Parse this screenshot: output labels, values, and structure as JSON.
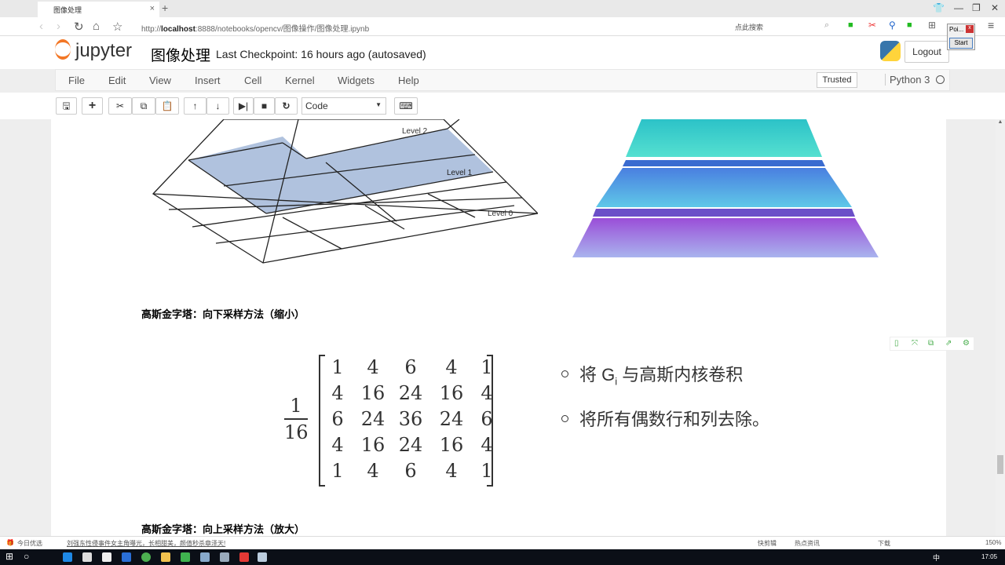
{
  "browser": {
    "tab_title": "图像处理",
    "url_prefix": "http://",
    "url_host": "localhost",
    "url_rest": ":8888/notebooks/opencv/图像操作/图像处理.ipynb",
    "search_placeholder": "点此搜索"
  },
  "header": {
    "logo": "jupyter",
    "notebook_name": "图像处理",
    "checkpoint": "Last Checkpoint: 16 hours ago (autosaved)",
    "logout": "Logout"
  },
  "popup": {
    "title": "Poi...",
    "close": "x",
    "start": "Start"
  },
  "menu": [
    "File",
    "Edit",
    "View",
    "Insert",
    "Cell",
    "Kernel",
    "Widgets",
    "Help"
  ],
  "trusted": "Trusted",
  "kernel": "Python 3",
  "toolbar": {
    "cell_type": "Code"
  },
  "content": {
    "diagram_labels": [
      "Level 2",
      "Level 1",
      "Level 0"
    ],
    "heading_down": "高斯金字塔：向下采样方法（缩小）",
    "fraction": {
      "num": "1",
      "den": "16"
    },
    "matrix": [
      [
        "1",
        "4",
        "6",
        "4",
        "1"
      ],
      [
        "4",
        "16",
        "24",
        "16",
        "4"
      ],
      [
        "6",
        "24",
        "36",
        "24",
        "6"
      ],
      [
        "4",
        "16",
        "24",
        "16",
        "4"
      ],
      [
        "1",
        "4",
        "6",
        "4",
        "1"
      ]
    ],
    "bullet1_a": "将 G",
    "bullet1_sub": "i",
    "bullet1_b": " 与高斯内核卷积",
    "bullet2": "将所有偶数行和列去除。",
    "heading_up": "高斯金字塔：向上采样方法（放大）"
  },
  "statusbar": {
    "left_label": "今日优选",
    "news": "刘强东性侵事件女主角曝光，长相甜美，颜值秒杀章泽天!",
    "items": [
      "快剪辑",
      "热点资讯",
      "下载"
    ],
    "zoom": "150%"
  },
  "taskbar": {
    "ime": "中",
    "clock": "17:05"
  }
}
